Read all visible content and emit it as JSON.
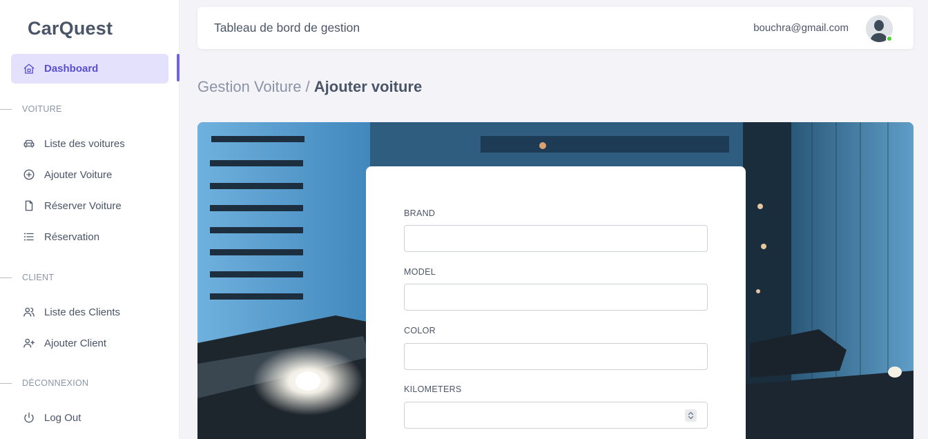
{
  "app": {
    "name": "CarQuest"
  },
  "sidebar": {
    "active": {
      "label": "Dashboard"
    },
    "sections": [
      {
        "title": "VOITURE",
        "items": [
          {
            "label": "Liste des voitures"
          },
          {
            "label": "Ajouter Voiture"
          },
          {
            "label": "Réserver Voiture"
          },
          {
            "label": "Réservation"
          }
        ]
      },
      {
        "title": "CLIENT",
        "items": [
          {
            "label": "Liste des Clients"
          },
          {
            "label": "Ajouter Client"
          }
        ]
      },
      {
        "title": "DÉCONNEXION",
        "items": [
          {
            "label": "Log Out"
          }
        ]
      }
    ]
  },
  "header": {
    "title": "Tableau de bord de gestion",
    "email": "bouchra@gmail.com",
    "status_color": "#4cd137"
  },
  "breadcrumb": {
    "parent": "Gestion Voiture / ",
    "current": "Ajouter voiture"
  },
  "form": {
    "fields": [
      {
        "label": "BRAND",
        "value": ""
      },
      {
        "label": "MODEL",
        "value": ""
      },
      {
        "label": "COLOR",
        "value": ""
      },
      {
        "label": "KILOMETERS",
        "value": ""
      }
    ]
  },
  "colors": {
    "accent": "#5a4fcf",
    "accent_bg": "#e3e1fb",
    "text": "#4a5568",
    "muted": "#8a94a6"
  }
}
